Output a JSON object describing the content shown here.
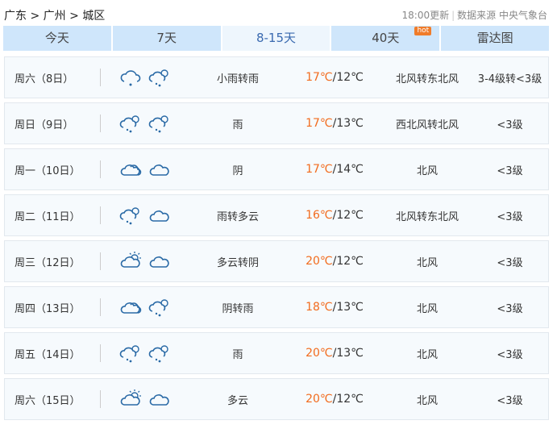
{
  "breadcrumb": "广东 > 广州 > 城区",
  "update_time": "18:00更新",
  "source": "数据来源 中央气象台",
  "tabs": [
    {
      "label": "今天"
    },
    {
      "label": "7天"
    },
    {
      "label": "8-15天",
      "active": true
    },
    {
      "label": "40天",
      "badge": "hot"
    },
    {
      "label": "雷达图"
    }
  ],
  "rows": [
    {
      "day": "周六（8日）",
      "icons": [
        "rain-icon",
        "rain-cloud-icon"
      ],
      "desc": "小雨转雨",
      "high": "17℃",
      "low": "/12℃",
      "wind": "北风转东北风",
      "level": "3-4级转<3级"
    },
    {
      "day": "周日（9日）",
      "icons": [
        "rain-cloud-icon",
        "rain-cloud-icon"
      ],
      "desc": "雨",
      "high": "17℃",
      "low": "/13℃",
      "wind": "西北风转北风",
      "level": "<3级"
    },
    {
      "day": "周一（10日）",
      "icons": [
        "overcast-icon",
        "cloudy-night-icon"
      ],
      "desc": "阴",
      "high": "17℃",
      "low": "/14℃",
      "wind": "北风",
      "level": "<3级"
    },
    {
      "day": "周二（11日）",
      "icons": [
        "rain-cloud-icon",
        "cloudy-night-icon"
      ],
      "desc": "雨转多云",
      "high": "16℃",
      "low": "/12℃",
      "wind": "北风转东北风",
      "level": "<3级"
    },
    {
      "day": "周三（12日）",
      "icons": [
        "cloudy-day-icon",
        "cloudy-night-icon"
      ],
      "desc": "多云转阴",
      "high": "20℃",
      "low": "/12℃",
      "wind": "北风",
      "level": "<3级"
    },
    {
      "day": "周四（13日）",
      "icons": [
        "overcast-icon",
        "rain-cloud-icon"
      ],
      "desc": "阴转雨",
      "high": "18℃",
      "low": "/13℃",
      "wind": "北风",
      "level": "<3级"
    },
    {
      "day": "周五（14日）",
      "icons": [
        "rain-cloud-icon",
        "rain-cloud-icon"
      ],
      "desc": "雨",
      "high": "20℃",
      "low": "/13℃",
      "wind": "北风",
      "level": "<3级"
    },
    {
      "day": "周六（15日）",
      "icons": [
        "cloudy-day-icon",
        "cloudy-night-icon"
      ],
      "desc": "多云",
      "high": "20℃",
      "low": "/12℃",
      "wind": "北风",
      "level": "<3级"
    }
  ]
}
